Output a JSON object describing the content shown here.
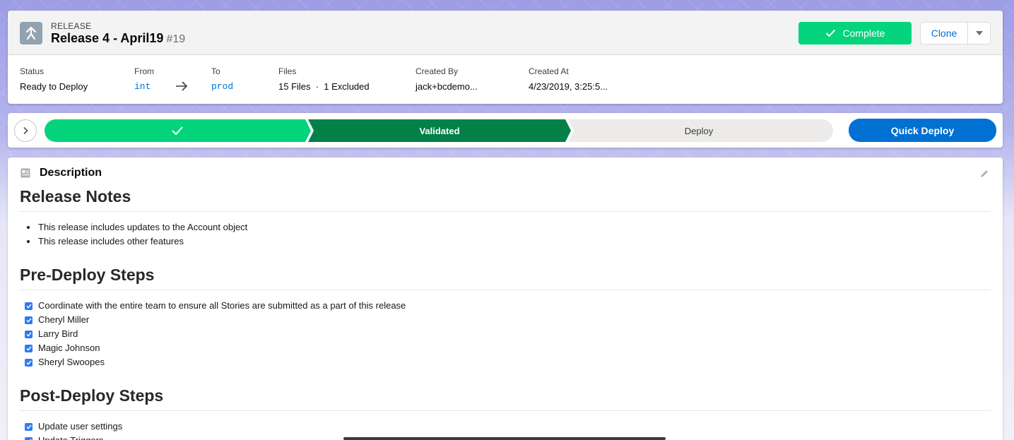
{
  "header": {
    "record_type": "RELEASE",
    "title": "Release 4 - April19",
    "number": "#19",
    "complete_label": "Complete",
    "clone_label": "Clone"
  },
  "fields": {
    "status": {
      "label": "Status",
      "value": "Ready to Deploy"
    },
    "from": {
      "label": "From",
      "value": "int"
    },
    "to": {
      "label": "To",
      "value": "prod"
    },
    "files": {
      "label": "Files",
      "value": "15 Files  ·  1 Excluded"
    },
    "created_by": {
      "label": "Created By",
      "value": "jack+bcdemo..."
    },
    "created_at": {
      "label": "Created At",
      "value": "4/23/2019, 3:25:5..."
    }
  },
  "path": {
    "stages": [
      {
        "label": "",
        "state": "complete",
        "color": "#04d47c"
      },
      {
        "label": "Validated",
        "state": "current",
        "color": "#028048"
      },
      {
        "label": "Deploy",
        "state": "incomplete",
        "color": "#ecebea"
      }
    ],
    "quick_deploy_label": "Quick Deploy"
  },
  "description": {
    "title": "Description",
    "release_notes": {
      "heading": "Release Notes",
      "items": [
        "This release includes updates to the Account object",
        "This release includes other features"
      ]
    },
    "pre_deploy": {
      "heading": "Pre-Deploy Steps",
      "items": [
        "Coordinate with the entire team to ensure all Stories are submitted as a part of this release",
        "Cheryl Miller",
        "Larry Bird",
        "Magic Johnson",
        "Sheryl Swoopes"
      ]
    },
    "post_deploy": {
      "heading": "Post-Deploy Steps",
      "items": [
        "Update user settings",
        "Update Triggers"
      ]
    }
  },
  "colors": {
    "accent": "#0070d2",
    "success": "#04d47c",
    "validated": "#028048"
  }
}
